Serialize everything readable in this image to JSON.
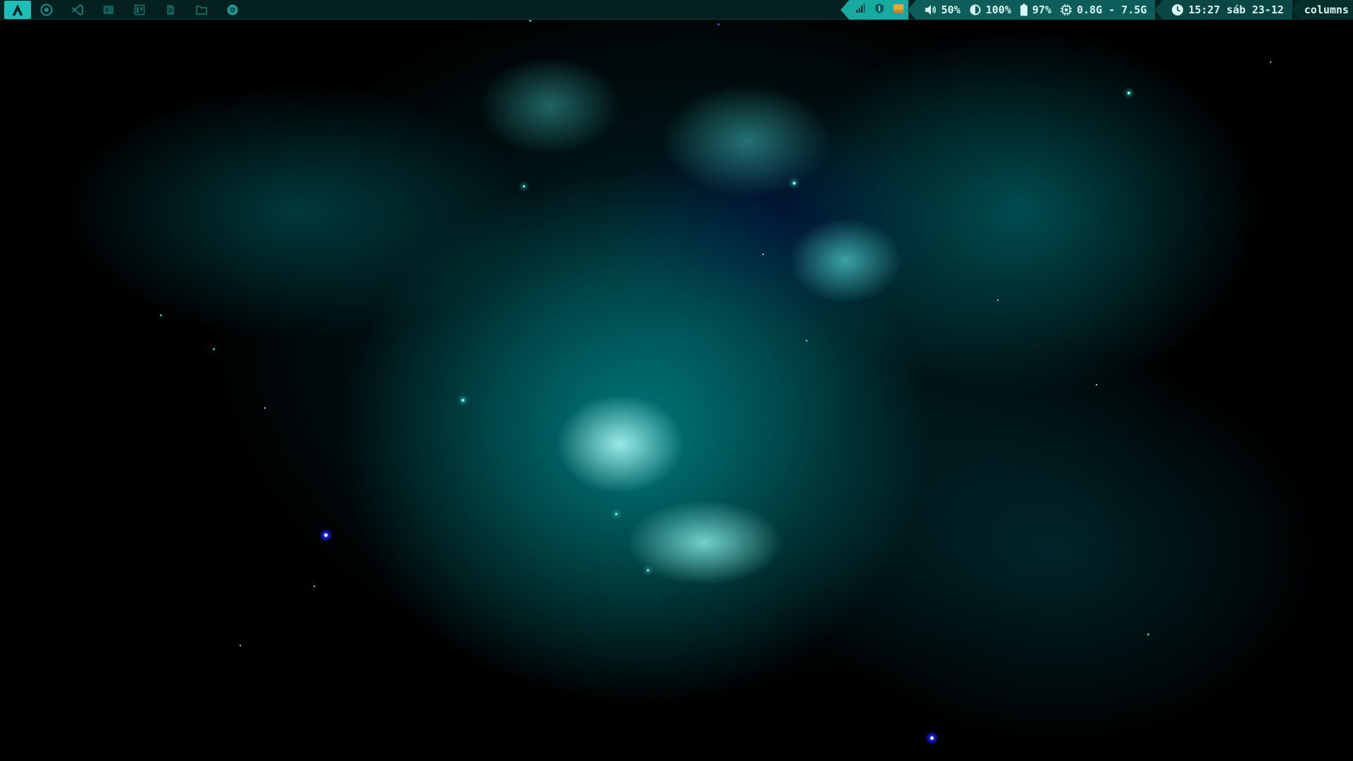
{
  "topbar": {
    "launcher": {
      "icon": "arch-logo-icon"
    },
    "tasks": [
      {
        "icon": "chrome-icon"
      },
      {
        "icon": "vscode-icon"
      },
      {
        "icon": "terminal-icon"
      },
      {
        "icon": "kanban-icon"
      },
      {
        "icon": "document-icon"
      },
      {
        "icon": "folder-icon"
      },
      {
        "icon": "spotify-icon"
      }
    ],
    "tray": [
      {
        "icon": "network-signal-icon"
      },
      {
        "icon": "shield-icon"
      },
      {
        "icon": "orange-app-icon"
      }
    ],
    "volume": {
      "icon": "speaker-icon",
      "value": "50%"
    },
    "brightness": {
      "icon": "brightness-icon",
      "value": "100%"
    },
    "battery": {
      "icon": "battery-icon",
      "value": "97%"
    },
    "memory": {
      "icon": "cpu-icon",
      "value": "0.8G - 7.5G"
    },
    "clock": {
      "icon": "clock-icon",
      "value": "15:27 sáb 23-12"
    },
    "layout": {
      "value": "columns"
    }
  },
  "colors": {
    "bar_bg": "#04201f",
    "accent": "#1bbfb7",
    "tray_bg": "#17aaa3",
    "text": "#d9f7f5",
    "nebula": "#00a0a0"
  }
}
